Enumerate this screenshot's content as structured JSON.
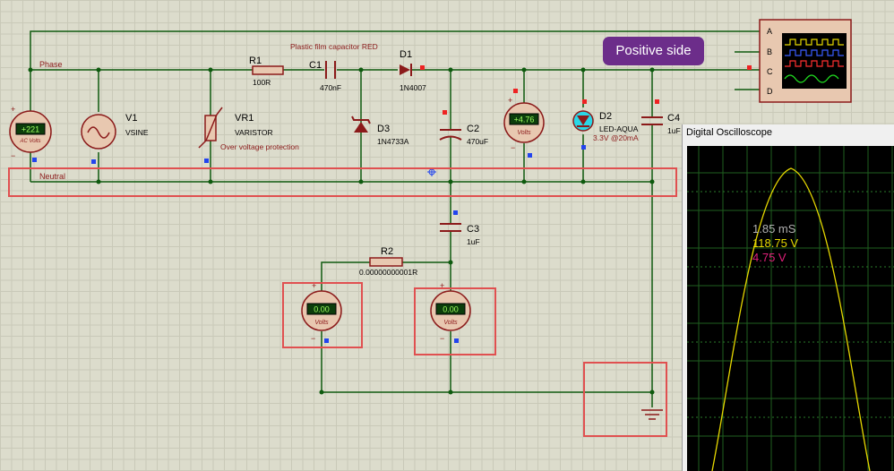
{
  "colors": {
    "wire": "#0e5a0e",
    "component": "#8b1a1a",
    "label": "#000000",
    "component_label": "#8b1a1a",
    "highlight_box": "#e05050",
    "callout_bg": "#6c2d8a",
    "scope_trace": "#e6d800",
    "scope_grid": "#1f5f1f",
    "readout_time": "#b0b0b0",
    "readout_v1": "#e6d800",
    "readout_v2": "#e0207a"
  },
  "nets": {
    "phase": "Phase",
    "neutral": "Neutral"
  },
  "components": {
    "v1": {
      "ref": "V1",
      "value": "VSINE"
    },
    "vr1": {
      "ref": "VR1",
      "value": "VARISTOR",
      "note": "Over voltage protection"
    },
    "r1": {
      "ref": "R1",
      "value": "100R"
    },
    "c1": {
      "ref": "C1",
      "value": "470nF",
      "note": "Plastic film capacitor RED"
    },
    "d1": {
      "ref": "D1",
      "value": "1N4007"
    },
    "d3": {
      "ref": "D3",
      "value": "1N4733A"
    },
    "c2": {
      "ref": "C2",
      "value": "470uF"
    },
    "d2": {
      "ref": "D2",
      "value": "LED-AQUA",
      "note": "3.3V @20mA"
    },
    "c4": {
      "ref": "C4",
      "value": "1uF"
    },
    "c3": {
      "ref": "C3",
      "value": "1uF"
    },
    "r2": {
      "ref": "R2",
      "value": "0.00000000001R"
    }
  },
  "meters": {
    "ac": {
      "reading": "+221",
      "unit": "AC Volts"
    },
    "dc1": {
      "reading": "+4.76",
      "unit": "Volts"
    },
    "v_left": {
      "reading": "0.00",
      "unit": "Volts"
    },
    "v_right": {
      "reading": "0.00",
      "unit": "Volts"
    }
  },
  "oscilloscope_block": {
    "channels": [
      "A",
      "B",
      "C",
      "D"
    ]
  },
  "callout": {
    "text": "Positive side"
  },
  "scope_window": {
    "title": "Digital Oscilloscope",
    "time": "1.85 mS",
    "v1": "118.75 V",
    "v2": "4.75 V"
  },
  "markers": {
    "plus": "+",
    "minus": "−"
  }
}
